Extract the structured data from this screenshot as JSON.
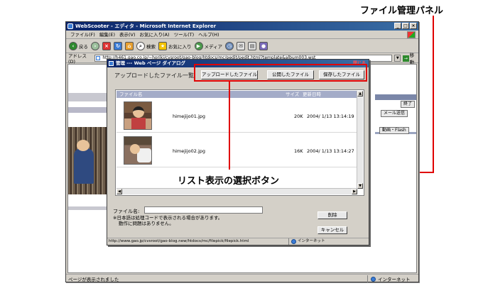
{
  "annotations": {
    "panel_label": "ファイル管理パネル",
    "buttons_label": "リスト表示の選択ボタン"
  },
  "browser": {
    "title": "WebScooter - エディタ - Microsoft Internet Explorer",
    "menu": [
      "ファイル(F)",
      "編集(E)",
      "表示(V)",
      "お気に入り(A)",
      "ツール(T)",
      "ヘルプ(H)"
    ],
    "toolbar": {
      "back": "戻る",
      "search": "検索",
      "favorites": "お気に入り",
      "media": "メディア"
    },
    "address_label": "アドレス(D)",
    "address_url": "http://h461.gao.co.jp/~horiki/cvsroot/gao-blog/htdocs/mc/pedit/pedit.html?template&album003.wst",
    "go_label": "移動",
    "status_text": "ページが表示されました",
    "zone_text": "インターネット",
    "right_buttons": {
      "finish": "終了",
      "mail_send": "メール送信",
      "video_flash": "動画・Flash"
    }
  },
  "dialog": {
    "title": "管理 --- Web ページ ダイアログ",
    "close_label": "閉じる",
    "heading": "アップロードしたファイル一覧",
    "tabs": {
      "uploaded": "アップロードしたファイル",
      "published": "公開したファイル",
      "saved": "保存したファイル"
    },
    "columns": {
      "name": "ファイル名",
      "size": "サイズ",
      "updated": "更新日時"
    },
    "files": [
      {
        "name": "himejijo01.jpg",
        "size": "20K",
        "date": "2004/ 1/13 13:14:19"
      },
      {
        "name": "himejijo02.jpg",
        "size": "16K",
        "date": "2004/ 1/13 13:14:27"
      }
    ],
    "filename_label": "ファイル名:",
    "filename_value": "",
    "note_line1": "※日本語は処理コードで表示される場合があります。",
    "note_line2": "動作に問題はありません。",
    "delete_label": "削除",
    "cancel_label": "キャンセル",
    "status_url": "http://www.gao.jp/cvsroot/gao-blog.new/htdocs/mc/filepick/filepick.html",
    "zone_text": "インターネット"
  },
  "colors": {
    "annotation": "#e00000",
    "titlebar": "#0a246a",
    "list_header": "#a4acc8"
  }
}
